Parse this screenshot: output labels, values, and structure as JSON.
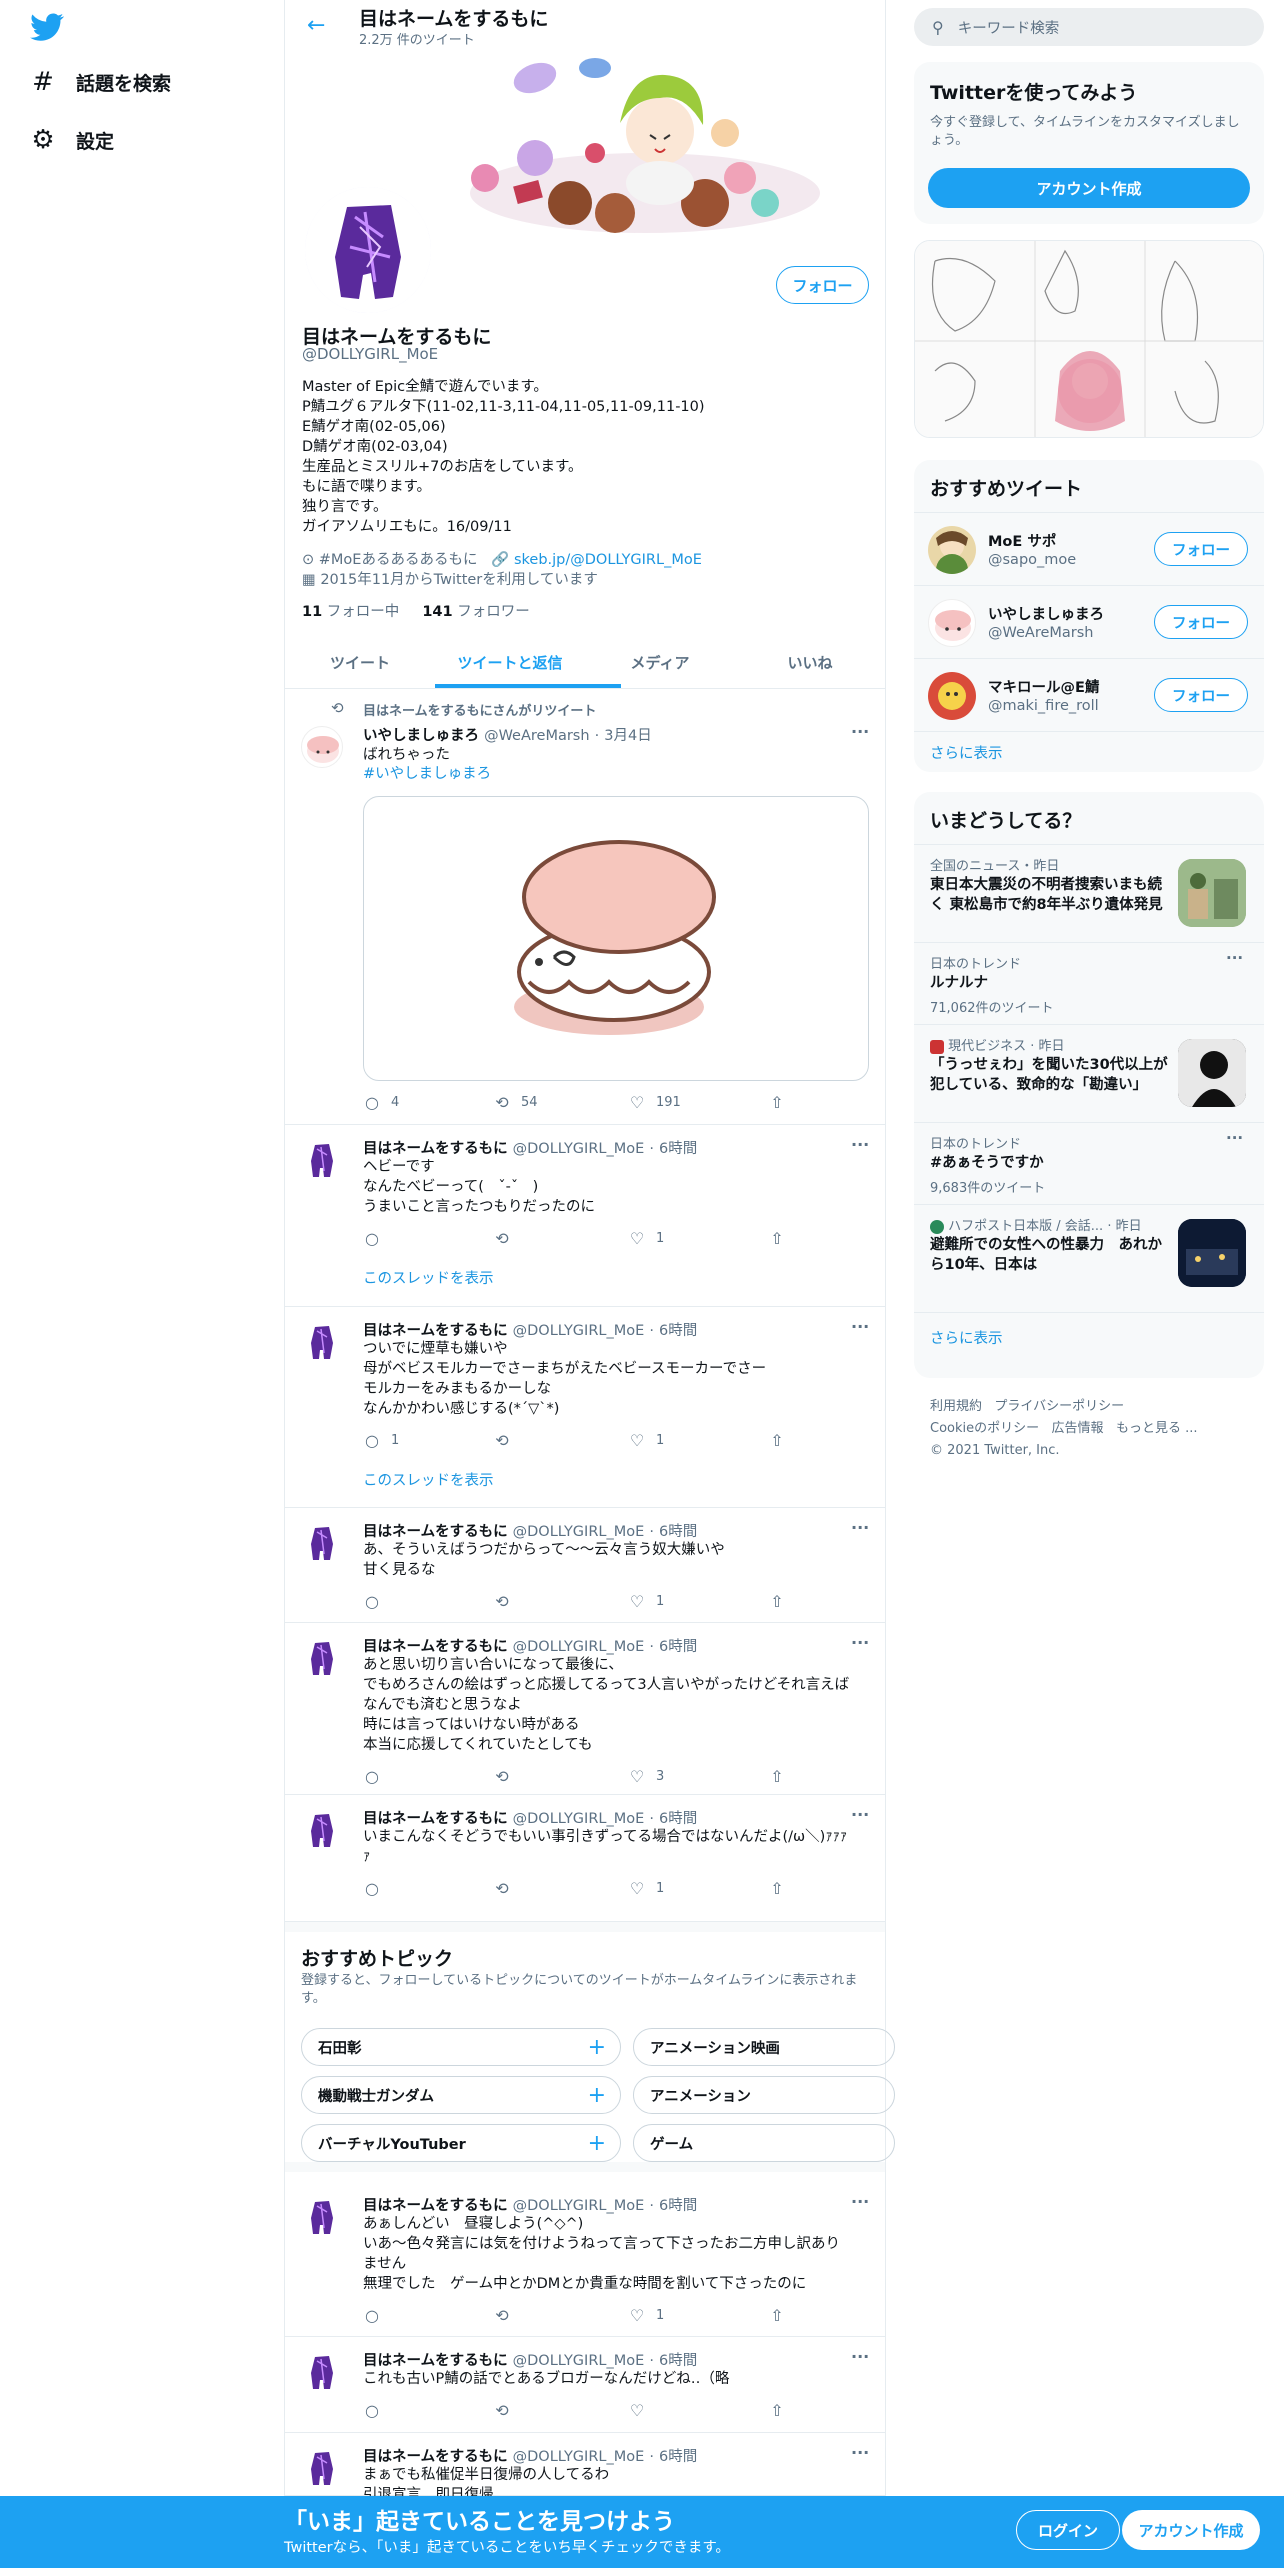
{
  "nav": {
    "explore_label": "話題を検索",
    "settings_label": "設定"
  },
  "header": {
    "title": "目はネームをするもに",
    "tweet_count": "2.2万 件のツイート"
  },
  "profile": {
    "follow_label": "フォロー",
    "name": "目はネームをするもに",
    "handle": "@DOLLYGIRL_MoE",
    "bio": [
      "Master of Epic全鯖で遊んでいます。",
      "P鯖ユグ６アルタ下(11-02,11-3,11-04,11-05,11-09,11-10)",
      "E鯖ゲオ南(02-05,06)",
      "D鯖ゲオ南(02-03,04)",
      "生産品とミスリル+7のお店をしています。",
      "もに語で喋ります。",
      "独り言です。",
      "ガイアソムリエもに。16/09/11"
    ],
    "location": "#MoEあるあるあるもに",
    "website": "skeb.jp/@DOLLYGIRL_MoE",
    "joined": "2015年11月からTwitterを利用しています",
    "following_count": "11",
    "following_label": "フォロー中",
    "followers_count": "141",
    "followers_label": "フォロワー"
  },
  "tabs": [
    "ツイート",
    "ツイートと返信",
    "メディア",
    "いいね"
  ],
  "retweet": {
    "label": "目はネームをするもにさんがリツイート",
    "name": "いやしましゅまろ",
    "handle": "@WeAreMarsh",
    "time": "3月4日",
    "text": "ばれちゃった",
    "hashtag": "#いやしましゅまろ",
    "replies": "4",
    "retweets": "54",
    "likes": "191"
  },
  "tweets": [
    {
      "name": "目はネームをするもに",
      "handle": "@DOLLYGIRL_MoE",
      "time": "6時間",
      "lines": [
        "ヘビーです",
        "なんたべビーって(　ˇ-ˇ　)",
        "うまいこと言ったつもりだったのに"
      ],
      "replies": "",
      "retweets": "",
      "likes": "1",
      "thread": "このスレッドを表示"
    },
    {
      "name": "目はネームをするもに",
      "handle": "@DOLLYGIRL_MoE",
      "time": "6時間",
      "lines": [
        "ついでに煙草も嫌いや",
        "母がベビスモルカーでさーまちがえたベビースモーカーでさー",
        "モルカーをみまもるかーしな",
        "なんかかわい感じする(*´▽`*)"
      ],
      "replies": "1",
      "retweets": "",
      "likes": "1",
      "thread": "このスレッドを表示"
    },
    {
      "name": "目はネームをするもに",
      "handle": "@DOLLYGIRL_MoE",
      "time": "6時間",
      "lines": [
        "あ、そういえばうつだからって〜〜云々言う奴大嫌いや",
        "甘く見るな"
      ],
      "replies": "",
      "retweets": "",
      "likes": "1"
    },
    {
      "name": "目はネームをするもに",
      "handle": "@DOLLYGIRL_MoE",
      "time": "6時間",
      "lines": [
        "あと思い切り言い合いになって最後に、",
        "でもめろさんの絵はずっと応援してるって3人言いやがったけどそれ言えば",
        "なんでも済むと思うなよ",
        "時には言ってはいけない時がある",
        "本当に応援してくれていたとしても"
      ],
      "replies": "",
      "retweets": "",
      "likes": "3"
    },
    {
      "name": "目はネームをするもに",
      "handle": "@DOLLYGIRL_MoE",
      "time": "6時間",
      "lines": [
        "いまこんなくそどうでもいい事引きずってる場合ではないんだよ(/ω＼)ｧｧｧ",
        "ｧ"
      ],
      "replies": "",
      "retweets": "",
      "likes": "1"
    }
  ],
  "topics": {
    "title": "おすすめトピック",
    "desc": "登録すると、フォローしているトピックについてのツイートがホームタイムラインに表示されます。",
    "items": [
      "石田彰",
      "アニメーション映画",
      "機動戦士ガンダム",
      "アニメーション",
      "バーチャルYouTuber",
      "ゲーム"
    ]
  },
  "tweets2": [
    {
      "name": "目はネームをするもに",
      "handle": "@DOLLYGIRL_MoE",
      "time": "6時間",
      "lines": [
        "あぁしんどい　昼寝しよう(^◇^)",
        "いあ～色々発言には気を付けようねって言って下さったお二方申し訳あり",
        "ません",
        "無理でした　ゲーム中とかDMとか貴重な時間を割いて下さったのに"
      ],
      "replies": "",
      "retweets": "",
      "likes": "1"
    },
    {
      "name": "目はネームをするもに",
      "handle": "@DOLLYGIRL_MoE",
      "time": "6時間",
      "lines": [
        "これも古いP鯖の話でとあるブロガーなんだけどね‥（略"
      ],
      "replies": "",
      "retweets": "",
      "likes": ""
    },
    {
      "name": "目はネームをするもに",
      "handle": "@DOLLYGIRL_MoE",
      "time": "6時間",
      "lines": [
        "まぁでも私催促半日復帰の人してるわ",
        "引退宣言　即日復帰"
      ],
      "replies": "",
      "retweets": "",
      "likes": ""
    }
  ],
  "sidebar": {
    "search_placeholder": "キーワード検索",
    "signup_card": {
      "title": "Twitterを使ってみよう",
      "desc": "今すぐ登録して、タイムラインをカスタマイズしましょう。",
      "button": "アカウント作成"
    },
    "recommend": {
      "title": "おすすめツイート",
      "follow": "フォロー",
      "more": "さらに表示",
      "users": [
        {
          "name": "MoE サポ",
          "handle": "@sapo_moe"
        },
        {
          "name": "いやしましゅまろ",
          "handle": "@WeAreMarsh"
        },
        {
          "name": "マキロール@E鯖",
          "handle": "@maki_fire_roll"
        }
      ]
    },
    "trends": {
      "title": "いまどうしてる？",
      "more": "さらに表示",
      "items": [
        {
          "cat": "全国のニュース・昨日",
          "text": "東日本大震災の不明者捜索いまも続く 東松島市で約8年半ぶり遺体発見"
        },
        {
          "cat": "日本のトレンド",
          "text": "ルナルナ",
          "count": "71,062件のツイート"
        },
        {
          "cat": "現代ビジネス · 昨日",
          "text": "「うっせぇわ」を聞いた30代以上が犯している、致命的な「勘違い」"
        },
        {
          "cat": "日本のトレンド",
          "text": "#あぁそうですか",
          "count": "9,683件のツイート"
        },
        {
          "cat": "ハフポスト日本版 / 会話... · 昨日",
          "text": "避難所での女性への性暴力　あれから10年、日本は"
        }
      ]
    },
    "footer": {
      "links": [
        "利用規約",
        "プライバシーポリシー",
        "Cookieのポリシー",
        "広告情報",
        "もっと見る ..."
      ],
      "copyright": "© 2021 Twitter, Inc."
    }
  },
  "bottom_bar": {
    "title": "「いま」起きていることを見つけよう",
    "sub": "Twitterなら、「いま」起きていることをいち早くチェックできます。",
    "login": "ログイン",
    "signup": "アカウント作成"
  },
  "colors": {
    "accent": "#1da1f2",
    "muted": "#5b7083",
    "border": "#e6ecf0"
  }
}
